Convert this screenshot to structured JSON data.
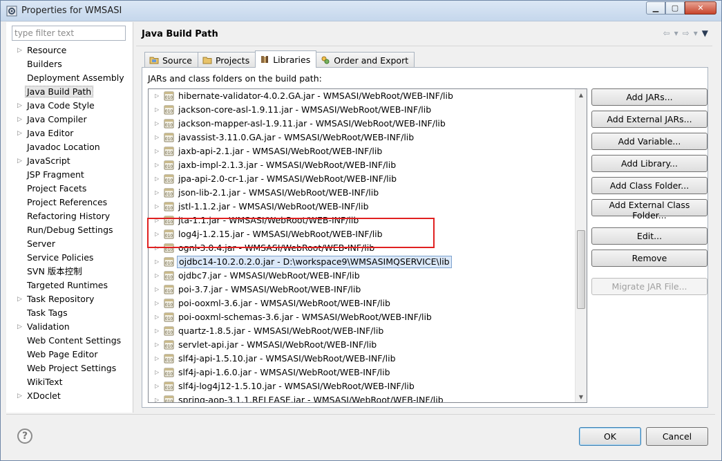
{
  "window": {
    "title": "Properties for WMSASI",
    "controls": {
      "minimize": "▁",
      "maximize": "▢",
      "close": "✕"
    }
  },
  "sidebar": {
    "filter_placeholder": "type filter text",
    "items": [
      {
        "label": "Resource",
        "expandable": true
      },
      {
        "label": "Builders",
        "expandable": false
      },
      {
        "label": "Deployment Assembly",
        "expandable": false
      },
      {
        "label": "Java Build Path",
        "expandable": false,
        "selected": true
      },
      {
        "label": "Java Code Style",
        "expandable": true
      },
      {
        "label": "Java Compiler",
        "expandable": true
      },
      {
        "label": "Java Editor",
        "expandable": true
      },
      {
        "label": "Javadoc Location",
        "expandable": false
      },
      {
        "label": "JavaScript",
        "expandable": true
      },
      {
        "label": "JSP Fragment",
        "expandable": false
      },
      {
        "label": "Project Facets",
        "expandable": false
      },
      {
        "label": "Project References",
        "expandable": false
      },
      {
        "label": "Refactoring History",
        "expandable": false
      },
      {
        "label": "Run/Debug Settings",
        "expandable": false
      },
      {
        "label": "Server",
        "expandable": false
      },
      {
        "label": "Service Policies",
        "expandable": false
      },
      {
        "label": "SVN 版本控制",
        "expandable": false
      },
      {
        "label": "Targeted Runtimes",
        "expandable": false
      },
      {
        "label": "Task Repository",
        "expandable": true
      },
      {
        "label": "Task Tags",
        "expandable": false
      },
      {
        "label": "Validation",
        "expandable": true
      },
      {
        "label": "Web Content Settings",
        "expandable": false
      },
      {
        "label": "Web Page Editor",
        "expandable": false
      },
      {
        "label": "Web Project Settings",
        "expandable": false
      },
      {
        "label": "WikiText",
        "expandable": false
      },
      {
        "label": "XDoclet",
        "expandable": true
      }
    ]
  },
  "main": {
    "title": "Java Build Path",
    "tabs": [
      {
        "label": "Source",
        "icon": "source-folder-icon"
      },
      {
        "label": "Projects",
        "icon": "projects-icon"
      },
      {
        "label": "Libraries",
        "icon": "libraries-icon",
        "active": true
      },
      {
        "label": "Order and Export",
        "icon": "order-export-icon"
      }
    ],
    "caption": "JARs and class folders on the build path:",
    "jars": [
      {
        "label": "hibernate-validator-4.0.2.GA.jar - WMSASI/WebRoot/WEB-INF/lib"
      },
      {
        "label": "jackson-core-asl-1.9.11.jar - WMSASI/WebRoot/WEB-INF/lib"
      },
      {
        "label": "jackson-mapper-asl-1.9.11.jar - WMSASI/WebRoot/WEB-INF/lib"
      },
      {
        "label": "javassist-3.11.0.GA.jar - WMSASI/WebRoot/WEB-INF/lib"
      },
      {
        "label": "jaxb-api-2.1.jar - WMSASI/WebRoot/WEB-INF/lib"
      },
      {
        "label": "jaxb-impl-2.1.3.jar - WMSASI/WebRoot/WEB-INF/lib"
      },
      {
        "label": "jpa-api-2.0-cr-1.jar - WMSASI/WebRoot/WEB-INF/lib"
      },
      {
        "label": "json-lib-2.1.jar - WMSASI/WebRoot/WEB-INF/lib"
      },
      {
        "label": "jstl-1.1.2.jar - WMSASI/WebRoot/WEB-INF/lib"
      },
      {
        "label": "jta-1.1.jar - WMSASI/WebRoot/WEB-INF/lib"
      },
      {
        "label": "log4j-1.2.15.jar - WMSASI/WebRoot/WEB-INF/lib"
      },
      {
        "label": "ognl-3.0.4.jar - WMSASI/WebRoot/WEB-INF/lib"
      },
      {
        "label": "ojdbc14-10.2.0.2.0.jar - D:\\workspace9\\WMSASIMQSERVICE\\lib",
        "selected": true
      },
      {
        "label": "ojdbc7.jar - WMSASI/WebRoot/WEB-INF/lib"
      },
      {
        "label": "poi-3.7.jar - WMSASI/WebRoot/WEB-INF/lib"
      },
      {
        "label": "poi-ooxml-3.6.jar - WMSASI/WebRoot/WEB-INF/lib"
      },
      {
        "label": "poi-ooxml-schemas-3.6.jar - WMSASI/WebRoot/WEB-INF/lib"
      },
      {
        "label": "quartz-1.8.5.jar - WMSASI/WebRoot/WEB-INF/lib"
      },
      {
        "label": "servlet-api.jar - WMSASI/WebRoot/WEB-INF/lib"
      },
      {
        "label": "slf4j-api-1.5.10.jar - WMSASI/WebRoot/WEB-INF/lib"
      },
      {
        "label": "slf4j-api-1.6.0.jar - WMSASI/WebRoot/WEB-INF/lib"
      },
      {
        "label": "slf4j-log4j12-1.5.10.jar - WMSASI/WebRoot/WEB-INF/lib"
      },
      {
        "label": "spring-aop-3.1.1.RELEASE.jar - WMSASI/WebRoot/WEB-INF/lib"
      }
    ],
    "buttons": {
      "add_jars": "Add JARs...",
      "add_external_jars": "Add External JARs...",
      "add_variable": "Add Variable...",
      "add_library": "Add Library...",
      "add_class_folder": "Add Class Folder...",
      "add_external_class_folder": "Add External Class Folder...",
      "edit": "Edit...",
      "remove": "Remove",
      "migrate_jar_file": "Migrate JAR File..."
    },
    "highlight_color": "#e02020"
  },
  "footer": {
    "help": "?",
    "ok": "OK",
    "cancel": "Cancel"
  }
}
